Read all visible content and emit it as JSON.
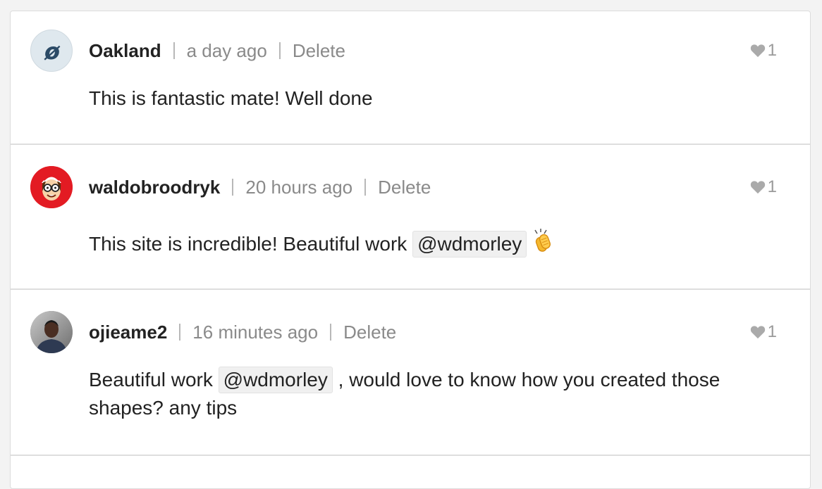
{
  "colors": {
    "text": "#222222",
    "meta": "#8a8a8a",
    "divider": "#dedede",
    "mention_bg": "#f0f0f0",
    "like": "#9a9a9a"
  },
  "comments": [
    {
      "username": "Oakland",
      "time": "a day ago",
      "delete_label": "Delete",
      "likes": "1",
      "avatar_icon": "oakland-logo-icon",
      "body": {
        "text1": "This is fantastic mate! Well done"
      }
    },
    {
      "username": "waldobroodryk",
      "time": "20 hours ago",
      "delete_label": "Delete",
      "likes": "1",
      "avatar_icon": "waldo-avatar-icon",
      "body": {
        "text1": "This site is incredible! Beautiful work ",
        "mention": "@wdmorley",
        "emoji": "clapping-hands-icon"
      }
    },
    {
      "username": "ojieame2",
      "time": "16 minutes ago",
      "delete_label": "Delete",
      "likes": "1",
      "avatar_icon": "user-photo-icon",
      "body": {
        "text1": "Beautiful work ",
        "mention": "@wdmorley",
        "text2": " , would love to know how you created those shapes? any tips"
      }
    }
  ]
}
